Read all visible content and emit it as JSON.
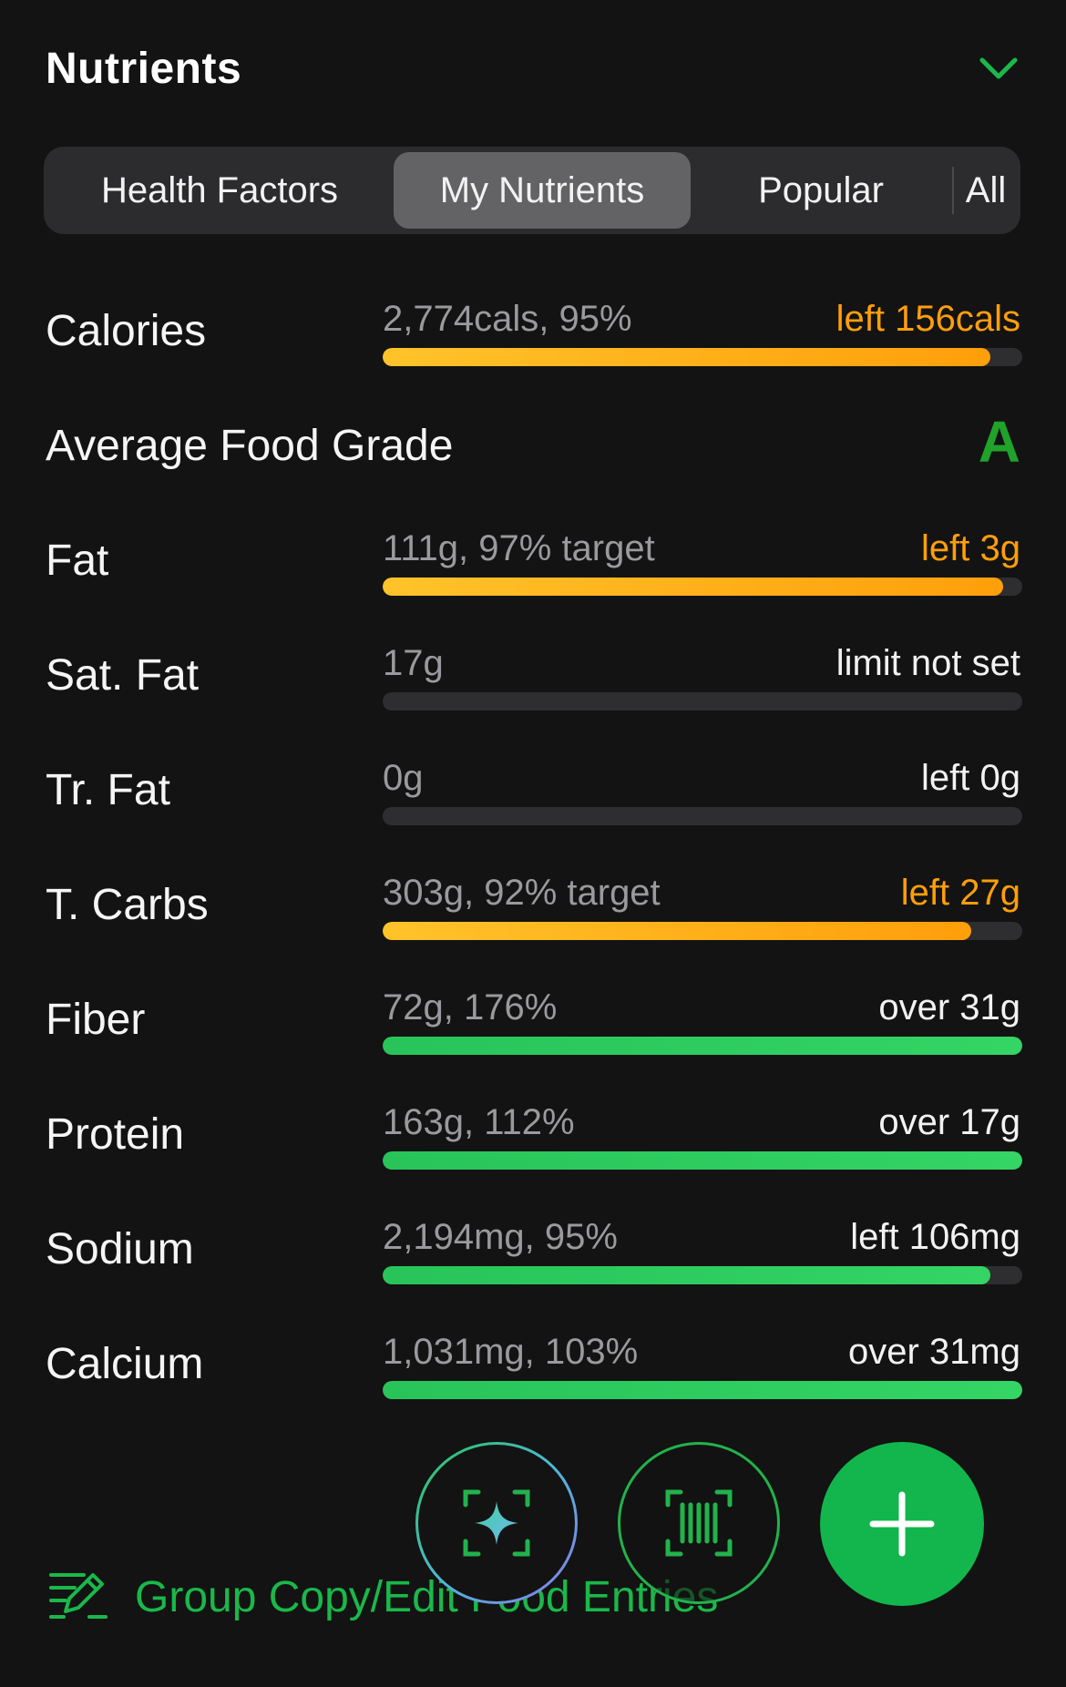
{
  "header": {
    "title": "Nutrients",
    "chevron_icon": "chevron-down-icon"
  },
  "tabs": [
    {
      "label": "Health Factors",
      "active": false
    },
    {
      "label": "My Nutrients",
      "active": true
    },
    {
      "label": "Popular",
      "active": false
    },
    {
      "label": "All",
      "active": false
    }
  ],
  "rows": {
    "calories": {
      "label": "Calories",
      "value": "2,774cals, 95%",
      "status": "left 156cals",
      "progress": 0.95,
      "color": "orange"
    },
    "grade": {
      "label": "Average Food Grade",
      "grade": "A"
    },
    "fat": {
      "label": "Fat",
      "value": "111g, 97% target",
      "status": "left 3g",
      "progress": 0.97,
      "color": "orange"
    },
    "sat_fat": {
      "label": "Sat. Fat",
      "value": "17g",
      "status": "limit not set",
      "progress": 0,
      "color": "none"
    },
    "tr_fat": {
      "label": "Tr. Fat",
      "value": "0g",
      "status": "left 0g",
      "progress": 0,
      "color": "none"
    },
    "t_carbs": {
      "label": "T. Carbs",
      "value": "303g, 92% target",
      "status": "left 27g",
      "progress": 0.92,
      "color": "orange"
    },
    "fiber": {
      "label": "Fiber",
      "value": "72g, 176%",
      "status": "over 31g",
      "progress": 1.0,
      "color": "green"
    },
    "protein": {
      "label": "Protein",
      "value": "163g, 112%",
      "status": "over 17g",
      "progress": 1.0,
      "color": "green"
    },
    "sodium": {
      "label": "Sodium",
      "value": "2,194mg, 95%",
      "status": "left 106mg",
      "progress": 0.95,
      "color": "green"
    },
    "calcium": {
      "label": "Calcium",
      "value": "1,031mg, 103%",
      "status": "over 31mg",
      "progress": 1.0,
      "color": "green"
    }
  },
  "colors": {
    "accent_green": "#12b64c",
    "warn_orange": "#ff9f0a",
    "grade_green": "#1fa32a"
  },
  "footer": {
    "link_label": "Group Copy/Edit Food Entries",
    "link_icon": "edit-list-icon"
  },
  "fabs": {
    "ai_icon": "sparkle-scan-icon",
    "barcode_icon": "barcode-scan-icon",
    "add_icon": "plus-icon"
  }
}
